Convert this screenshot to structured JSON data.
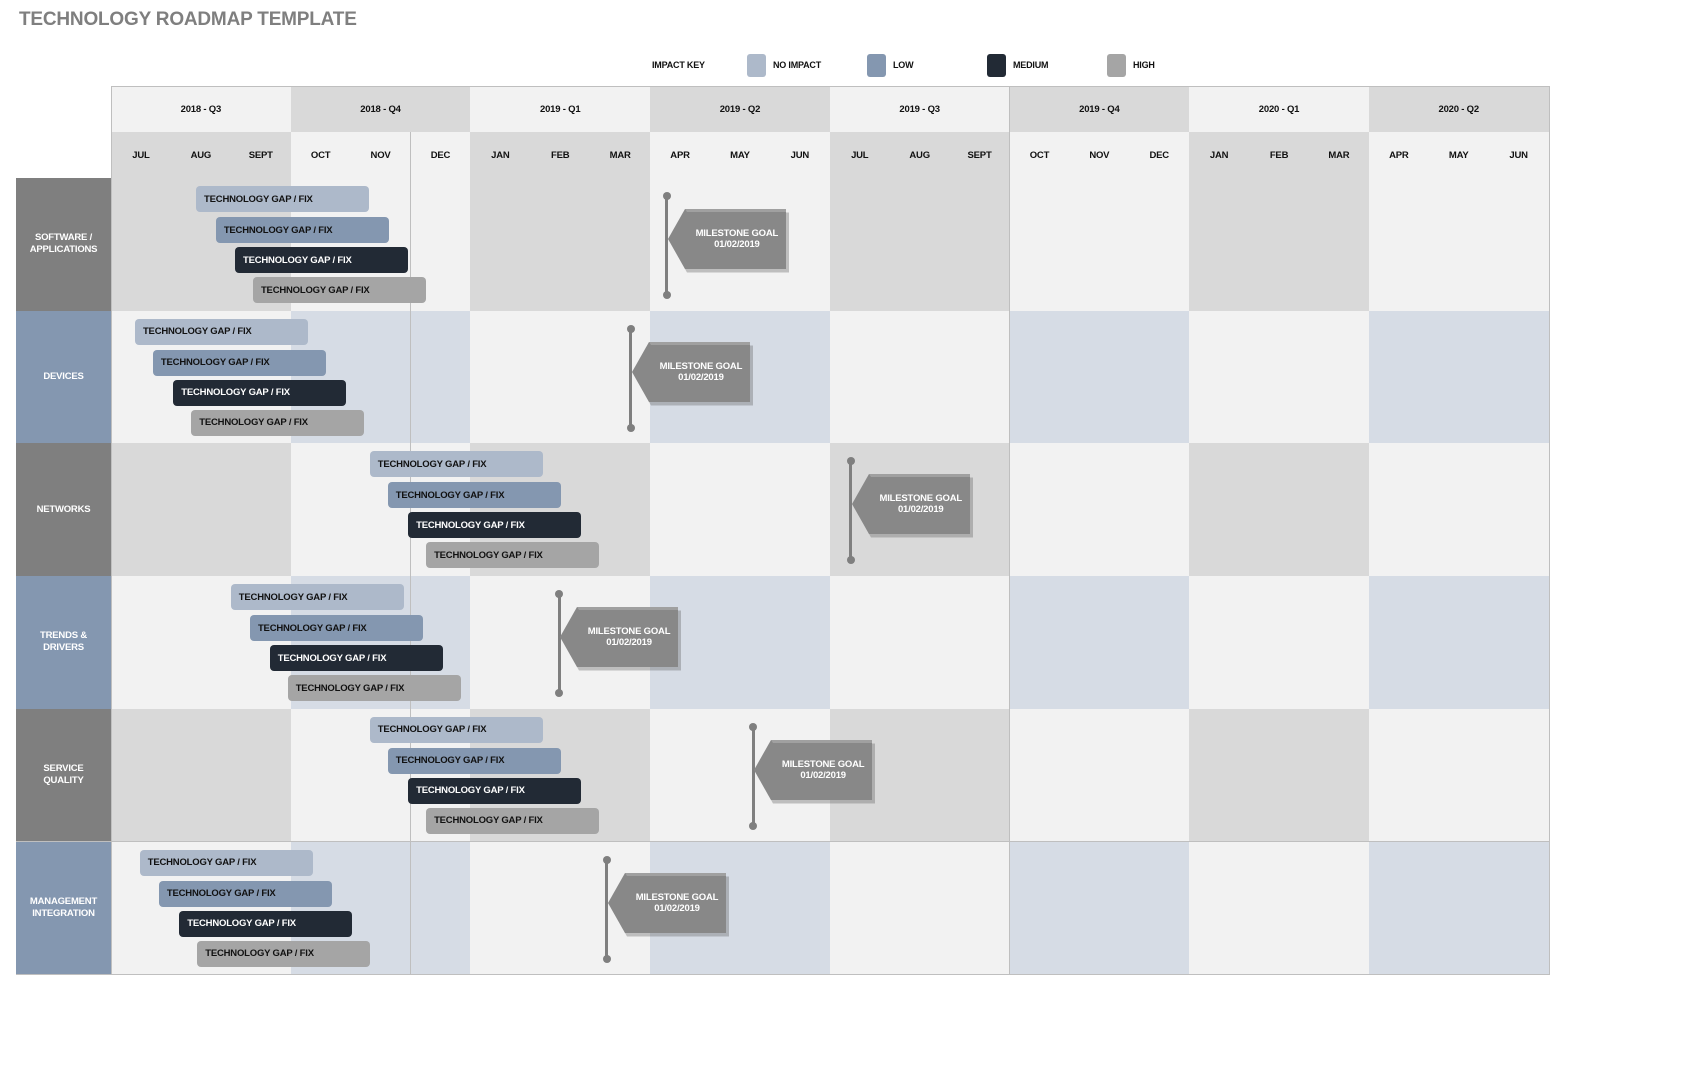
{
  "title": "TECHNOLOGY ROADMAP TEMPLATE",
  "legend": {
    "label": "IMPACT KEY",
    "items": [
      {
        "key": "none",
        "label": "NO IMPACT",
        "color": "#adb9ca",
        "text_color": "#111111"
      },
      {
        "key": "low",
        "label": "LOW",
        "color": "#8497b0",
        "text_color": "#111111"
      },
      {
        "key": "medium",
        "label": "MEDIUM",
        "color": "#222a35",
        "text_color": "#ffffff"
      },
      {
        "key": "high",
        "label": "HIGH",
        "color": "#a5a5a5",
        "text_color": "#111111"
      }
    ]
  },
  "colors": {
    "header_light": "#f2f2f2",
    "header_dark": "#d9d9d9",
    "gray_row_label": "#7f7f7f",
    "blue_row_label": "#8497b0",
    "gray_row_alt": "#d9d9d9",
    "blue_row_alt": "#d6dce5",
    "base_cell": "#f2f2f2",
    "milestone": "#888888",
    "grid_line": "#bfbfbf"
  },
  "quarters": [
    "2018 - Q3",
    "2018 - Q4",
    "2019 - Q1",
    "2019 - Q2",
    "2019 - Q3",
    "2019 - Q4",
    "2020 - Q1",
    "2020 - Q2"
  ],
  "months": [
    "JUL",
    "AUG",
    "SEPT",
    "OCT",
    "NOV",
    "DEC",
    "JAN",
    "FEB",
    "MAR",
    "APR",
    "MAY",
    "JUN",
    "JUL",
    "AUG",
    "SEPT",
    "OCT",
    "NOV",
    "DEC",
    "JAN",
    "FEB",
    "MAR",
    "APR",
    "MAY",
    "JUN"
  ],
  "rows": [
    {
      "label": "SOFTWARE /\nAPPLICATIONS",
      "style": "gray",
      "bars": [
        {
          "label": "TECHNOLOGY GAP / FIX",
          "impact": "none",
          "start_month": 1.42,
          "duration_months": 2.89
        },
        {
          "label": "TECHNOLOGY GAP / FIX",
          "impact": "low",
          "start_month": 1.75,
          "duration_months": 2.89
        },
        {
          "label": "TECHNOLOGY GAP / FIX",
          "impact": "medium",
          "start_month": 2.07,
          "duration_months": 2.89
        },
        {
          "label": "TECHNOLOGY GAP / FIX",
          "impact": "high",
          "start_month": 2.37,
          "duration_months": 2.89
        }
      ],
      "milestone": {
        "title": "MILESTONE GOAL",
        "date": "01/02/2019",
        "month_pos": 9.28
      }
    },
    {
      "label": "DEVICES",
      "style": "blue",
      "bars": [
        {
          "label": "TECHNOLOGY GAP / FIX",
          "impact": "none",
          "start_month": 0.4,
          "duration_months": 2.89
        },
        {
          "label": "TECHNOLOGY GAP / FIX",
          "impact": "low",
          "start_month": 0.7,
          "duration_months": 2.89
        },
        {
          "label": "TECHNOLOGY GAP / FIX",
          "impact": "medium",
          "start_month": 1.04,
          "duration_months": 2.89
        },
        {
          "label": "TECHNOLOGY GAP / FIX",
          "impact": "high",
          "start_month": 1.34,
          "duration_months": 2.89
        }
      ],
      "milestone": {
        "title": "MILESTONE GOAL",
        "date": "01/02/2019",
        "month_pos": 8.68
      }
    },
    {
      "label": "NETWORKS",
      "style": "gray",
      "bars": [
        {
          "label": "TECHNOLOGY GAP / FIX",
          "impact": "none",
          "start_month": 4.32,
          "duration_months": 2.89
        },
        {
          "label": "TECHNOLOGY GAP / FIX",
          "impact": "low",
          "start_month": 4.62,
          "duration_months": 2.89
        },
        {
          "label": "TECHNOLOGY GAP / FIX",
          "impact": "medium",
          "start_month": 4.96,
          "duration_months": 2.89
        },
        {
          "label": "TECHNOLOGY GAP / FIX",
          "impact": "high",
          "start_month": 5.26,
          "duration_months": 2.89
        }
      ],
      "milestone": {
        "title": "MILESTONE GOAL",
        "date": "01/02/2019",
        "month_pos": 12.35
      }
    },
    {
      "label": "TRENDS &\nDRIVERS",
      "style": "blue",
      "bars": [
        {
          "label": "TECHNOLOGY GAP / FIX",
          "impact": "none",
          "start_month": 2.0,
          "duration_months": 2.89
        },
        {
          "label": "TECHNOLOGY GAP / FIX",
          "impact": "low",
          "start_month": 2.32,
          "duration_months": 2.89
        },
        {
          "label": "TECHNOLOGY GAP / FIX",
          "impact": "medium",
          "start_month": 2.65,
          "duration_months": 2.89
        },
        {
          "label": "TECHNOLOGY GAP / FIX",
          "impact": "high",
          "start_month": 2.95,
          "duration_months": 2.89
        }
      ],
      "milestone": {
        "title": "MILESTONE GOAL",
        "date": "01/02/2019",
        "month_pos": 7.48
      }
    },
    {
      "label": "SERVICE\nQUALITY",
      "style": "gray",
      "bars": [
        {
          "label": "TECHNOLOGY GAP / FIX",
          "impact": "none",
          "start_month": 4.32,
          "duration_months": 2.89
        },
        {
          "label": "TECHNOLOGY GAP / FIX",
          "impact": "low",
          "start_month": 4.62,
          "duration_months": 2.89
        },
        {
          "label": "TECHNOLOGY GAP / FIX",
          "impact": "medium",
          "start_month": 4.96,
          "duration_months": 2.89
        },
        {
          "label": "TECHNOLOGY GAP / FIX",
          "impact": "high",
          "start_month": 5.26,
          "duration_months": 2.89
        }
      ],
      "milestone": {
        "title": "MILESTONE GOAL",
        "date": "01/02/2019",
        "month_pos": 10.72
      }
    },
    {
      "label": "MANAGEMENT\nINTEGRATION",
      "style": "blue",
      "bars": [
        {
          "label": "TECHNOLOGY GAP / FIX",
          "impact": "none",
          "start_month": 0.48,
          "duration_months": 2.89
        },
        {
          "label": "TECHNOLOGY GAP / FIX",
          "impact": "low",
          "start_month": 0.8,
          "duration_months": 2.89
        },
        {
          "label": "TECHNOLOGY GAP / FIX",
          "impact": "medium",
          "start_month": 1.14,
          "duration_months": 2.89
        },
        {
          "label": "TECHNOLOGY GAP / FIX",
          "impact": "high",
          "start_month": 1.44,
          "duration_months": 2.89
        }
      ],
      "milestone": {
        "title": "MILESTONE GOAL",
        "date": "01/02/2019",
        "month_pos": 8.28
      }
    }
  ]
}
